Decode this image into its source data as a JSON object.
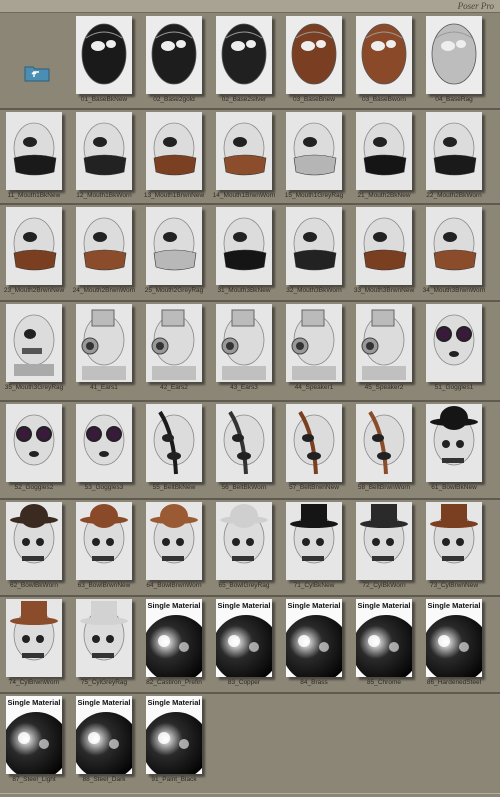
{
  "app": {
    "brand": "Poser Pro"
  },
  "folder": {
    "icon": "folder-up-icon"
  },
  "rows": [
    {
      "items": [
        {
          "label": "01_BaseBkNew",
          "kind": "mask",
          "tone": "#1a1a1a"
        },
        {
          "label": "02_Base2gold",
          "kind": "mask",
          "tone": "#1d1d1d"
        },
        {
          "label": "02_Base2silver",
          "kind": "mask",
          "tone": "#202020"
        },
        {
          "label": "03_BaseBnew",
          "kind": "mask",
          "tone": "#7a3e22"
        },
        {
          "label": "03_BaseBworn",
          "kind": "mask",
          "tone": "#8a4a2a"
        },
        {
          "label": "04_BaseRag",
          "kind": "mask",
          "tone": "#bdbdbd"
        }
      ]
    },
    {
      "items": [
        {
          "label": "11_Mouth1BkNew",
          "kind": "mouth",
          "tone": "#1a1a1a"
        },
        {
          "label": "12_Mouth1BkWorn",
          "kind": "mouth",
          "tone": "#222222"
        },
        {
          "label": "13_Mouth1BrwnNew",
          "kind": "mouth",
          "tone": "#7b3f22"
        },
        {
          "label": "14_Mouth1BrwnWorn",
          "kind": "mouth",
          "tone": "#8c4d2c"
        },
        {
          "label": "15_Mouth1GreyRag",
          "kind": "mouth",
          "tone": "#b5b5b5"
        },
        {
          "label": "21_Mouth2BkNew",
          "kind": "mouth",
          "tone": "#151515"
        },
        {
          "label": "22_Mouth2BkWorn",
          "kind": "mouth",
          "tone": "#1a1a1a"
        }
      ]
    },
    {
      "items": [
        {
          "label": "23_Mouth2BrwnNew",
          "kind": "mouth",
          "tone": "#7a3e20"
        },
        {
          "label": "24_Mouth2BrwnWorn",
          "kind": "mouth",
          "tone": "#8a4c2a"
        },
        {
          "label": "25_Mouth2GreyRag",
          "kind": "mouth",
          "tone": "#b8b8b8"
        },
        {
          "label": "31_Mouth3BkNew",
          "kind": "mouth",
          "tone": "#151515"
        },
        {
          "label": "32_Mouth3BkWorn",
          "kind": "mouth",
          "tone": "#222222"
        },
        {
          "label": "33_Mouth3BrwnNew",
          "kind": "mouth",
          "tone": "#7a3e20"
        },
        {
          "label": "34_Mouth3BrwnWorn",
          "kind": "mouth",
          "tone": "#8a4c2a"
        }
      ]
    },
    {
      "items": [
        {
          "label": "35_Mouth3GreyRag",
          "kind": "robot",
          "tone": "#c8c8c8"
        },
        {
          "label": "41_Ears1",
          "kind": "ear",
          "tone": "#d9d9d9"
        },
        {
          "label": "42_Ears2",
          "kind": "ear",
          "tone": "#d9d9d9"
        },
        {
          "label": "43_Ears3",
          "kind": "ear",
          "tone": "#d9d9d9"
        },
        {
          "label": "44_Speaker1",
          "kind": "ear",
          "tone": "#d9d9d9"
        },
        {
          "label": "45_Speaker2",
          "kind": "ear",
          "tone": "#d9d9d9"
        },
        {
          "label": "51_Goggles1",
          "kind": "goggle",
          "tone": "#c8c8c8"
        }
      ]
    },
    {
      "items": [
        {
          "label": "52_Goggles2",
          "kind": "goggle",
          "tone": "#c8c8c8"
        },
        {
          "label": "53_Goggles3",
          "kind": "goggle",
          "tone": "#c8c8c8"
        },
        {
          "label": "55_BeltBkNew",
          "kind": "belt",
          "tone": "#1a1a1a"
        },
        {
          "label": "56_BeltBkWorn",
          "kind": "belt",
          "tone": "#333333"
        },
        {
          "label": "57_BeltBrwnNew",
          "kind": "belt",
          "tone": "#7a3e20"
        },
        {
          "label": "58_BeltBrwnWorn",
          "kind": "belt",
          "tone": "#8a4c2a"
        },
        {
          "label": "61_BowlBkNew",
          "kind": "hat",
          "tone": "#151515"
        }
      ]
    },
    {
      "items": [
        {
          "label": "62_BowlBkWorn",
          "kind": "hat",
          "tone": "#3a2a20"
        },
        {
          "label": "63_BowlBrwnNew",
          "kind": "hat",
          "tone": "#8a4a2a"
        },
        {
          "label": "64_BowlBrwnWorn",
          "kind": "hat",
          "tone": "#9a5a33"
        },
        {
          "label": "65_BowlGreyRag",
          "kind": "hat",
          "tone": "#cfcfcf"
        },
        {
          "label": "71_CylBkNew",
          "kind": "tophat",
          "tone": "#151515"
        },
        {
          "label": "72_CylBkWorn",
          "kind": "tophat",
          "tone": "#2a2a2a"
        },
        {
          "label": "73_CylBrwnNew",
          "kind": "tophat",
          "tone": "#7a3e20"
        }
      ]
    },
    {
      "items": [
        {
          "label": "74_CylBrwnWorn",
          "kind": "tophat",
          "tone": "#8a4c2a"
        },
        {
          "label": "75_CylGreyRag",
          "kind": "tophat",
          "tone": "#d2d2d2"
        },
        {
          "label": "82_Castiron_Prefin",
          "kind": "material",
          "tone": "#2a2a2a",
          "title": "Single Material"
        },
        {
          "label": "83_Copper",
          "kind": "material",
          "tone": "#6a3a18",
          "title": "Single Material"
        },
        {
          "label": "84_Brass",
          "kind": "material",
          "tone": "#5a4a10",
          "title": "Single Material"
        },
        {
          "label": "85_Chrome",
          "kind": "material",
          "tone": "#222222",
          "title": "Single Material"
        },
        {
          "label": "86_HardenedSteel",
          "kind": "material",
          "tone": "#2a2a3a",
          "title": "Single Material"
        }
      ]
    },
    {
      "items": [
        {
          "label": "87_Steel_Light",
          "kind": "material",
          "tone": "#bcbcbc",
          "title": "Single Material"
        },
        {
          "label": "88_Steel_Dark",
          "kind": "material",
          "tone": "#555555",
          "title": "Single Material"
        },
        {
          "label": "91_Paint_Black",
          "kind": "material",
          "tone": "#111111",
          "title": "Single Material"
        }
      ]
    }
  ]
}
